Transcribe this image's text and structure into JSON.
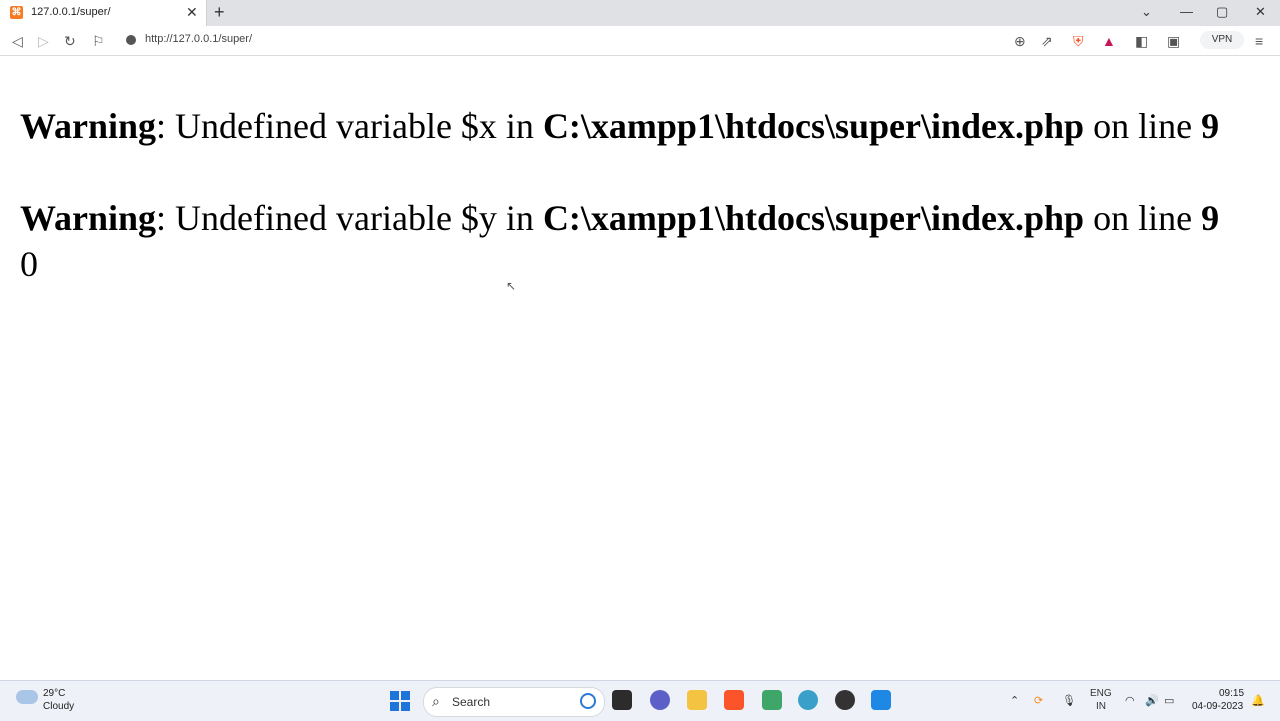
{
  "browser": {
    "tab_title": "127.0.0.1/super/",
    "url": "http://127.0.0.1/super/",
    "vpn_label": "VPN"
  },
  "page": {
    "warnings": [
      {
        "label": "Warning",
        "message": ": Undefined variable $x in ",
        "path": "C:\\xampp1\\htdocs\\super\\index.php",
        "on_text": " on line ",
        "line": "9"
      },
      {
        "label": "Warning",
        "message": ": Undefined variable $y in ",
        "path": "C:\\xampp1\\htdocs\\super\\index.php",
        "on_text": " on line ",
        "line": "9"
      }
    ],
    "output": "0"
  },
  "taskbar": {
    "temperature": "29°C",
    "weather": "Cloudy",
    "search_label": "Search",
    "lang_top": "ENG",
    "lang_bottom": "IN",
    "time": "09:15",
    "date": "04-09-2023"
  },
  "colors": {
    "accent": "#1e74d8",
    "brave": "#fb542b"
  }
}
